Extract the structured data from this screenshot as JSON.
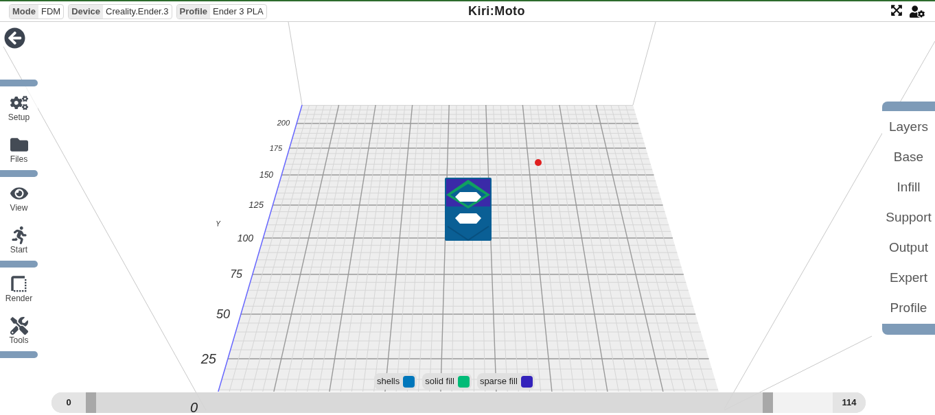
{
  "top_bar": {
    "fields": [
      {
        "label": "Mode",
        "value": "FDM"
      },
      {
        "label": "Device",
        "value": "Creality.Ender.3"
      },
      {
        "label": "Profile",
        "value": "Ender 3 PLA"
      }
    ],
    "title": "Kiri:Moto"
  },
  "left_menu": {
    "groups": [
      [
        {
          "label": "Setup",
          "kind": "setup"
        },
        {
          "label": "Files",
          "kind": "files"
        }
      ],
      [
        {
          "label": "View",
          "kind": "view"
        },
        {
          "label": "Start",
          "kind": "start"
        }
      ],
      [
        {
          "label": "Render",
          "kind": "render"
        },
        {
          "label": "Tools",
          "kind": "tools"
        }
      ]
    ]
  },
  "right_menu": [
    "Layers",
    "Base",
    "Infill",
    "Support",
    "Output",
    "Expert",
    "Profile"
  ],
  "scene": {
    "axis_label": "Y",
    "y_ticks": [
      "200",
      "175",
      "150",
      "125",
      "100",
      "75",
      "50",
      "25",
      "0"
    ]
  },
  "legend": [
    {
      "label": "shells",
      "color": "#0077bb"
    },
    {
      "label": "solid fill",
      "color": "#00bb77"
    },
    {
      "label": "sparse fill",
      "color": "#3322bb"
    }
  ],
  "layer_slider": {
    "start": "0",
    "end": "114",
    "level": 0.92
  }
}
